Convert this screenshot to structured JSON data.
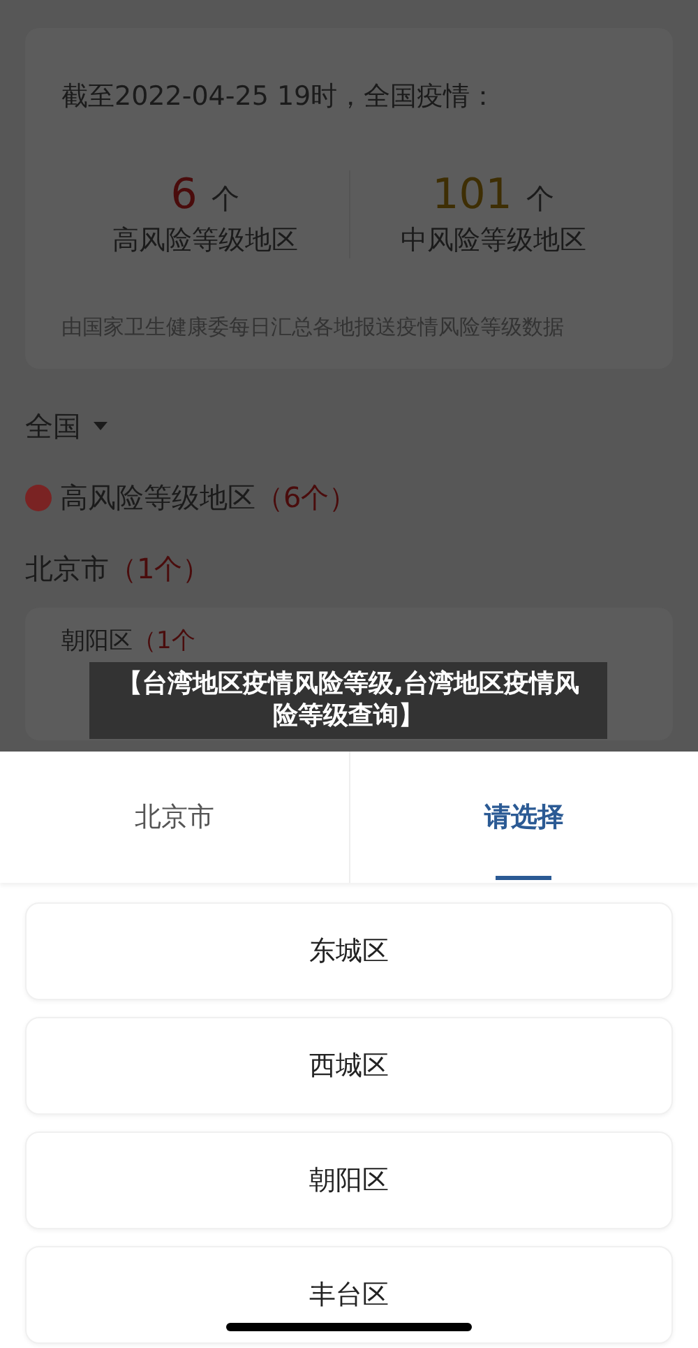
{
  "summary": {
    "as_of": "截至2022-04-25 19时，全国疫情：",
    "stats": [
      {
        "kind": "high",
        "count": "6",
        "unit": "个",
        "label": "高风险等级地区"
      },
      {
        "kind": "medium",
        "count": "101",
        "unit": "个",
        "label": "中风险等级地区"
      }
    ],
    "note": "由国家卫生健康委每日汇总各地报送疫情风险等级数据"
  },
  "region_filter": {
    "label": "全国"
  },
  "risk_group": {
    "color": "#7a2323",
    "title": "高风险等级地区",
    "count": "（6个）"
  },
  "city": {
    "name": "北京市",
    "count": "（1个）"
  },
  "districts": [
    {
      "name": "朝阳区",
      "count": "（1个"
    }
  ],
  "caption_banner": "【台湾地区疫情风险等级,台湾地区疫情风险等级查询】",
  "picker": {
    "tabs": [
      {
        "label": "北京市",
        "selected": false
      },
      {
        "label": "请选择",
        "selected": true
      }
    ],
    "options": [
      "东城区",
      "西城区",
      "朝阳区",
      "丰台区"
    ]
  }
}
